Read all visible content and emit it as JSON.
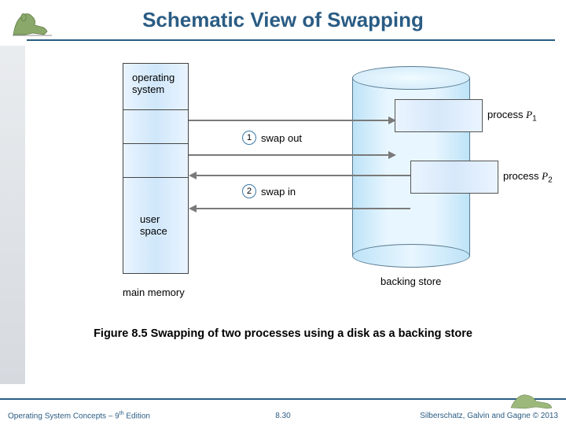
{
  "header": {
    "title": "Schematic View of Swapping"
  },
  "diagram": {
    "memory": {
      "os_label": "operating\nsystem",
      "user_label": "user\nspace",
      "main_memory_label": "main memory"
    },
    "backing_store": {
      "label": "backing store",
      "process1": "process P₁",
      "process2": "process P₂"
    },
    "arrows": {
      "swap_out_num": "1",
      "swap_out_label": "swap out",
      "swap_in_num": "2",
      "swap_in_label": "swap in"
    }
  },
  "caption": "Figure 8.5 Swapping of two processes using a disk as a backing store",
  "footer": {
    "left": "Operating System Concepts – 9th Edition",
    "center": "8.30",
    "right": "Silberschatz, Galvin and Gagne © 2013"
  },
  "icons": {
    "logo": "dinosaur-logo",
    "footer_logo": "dinosaur-footer"
  }
}
